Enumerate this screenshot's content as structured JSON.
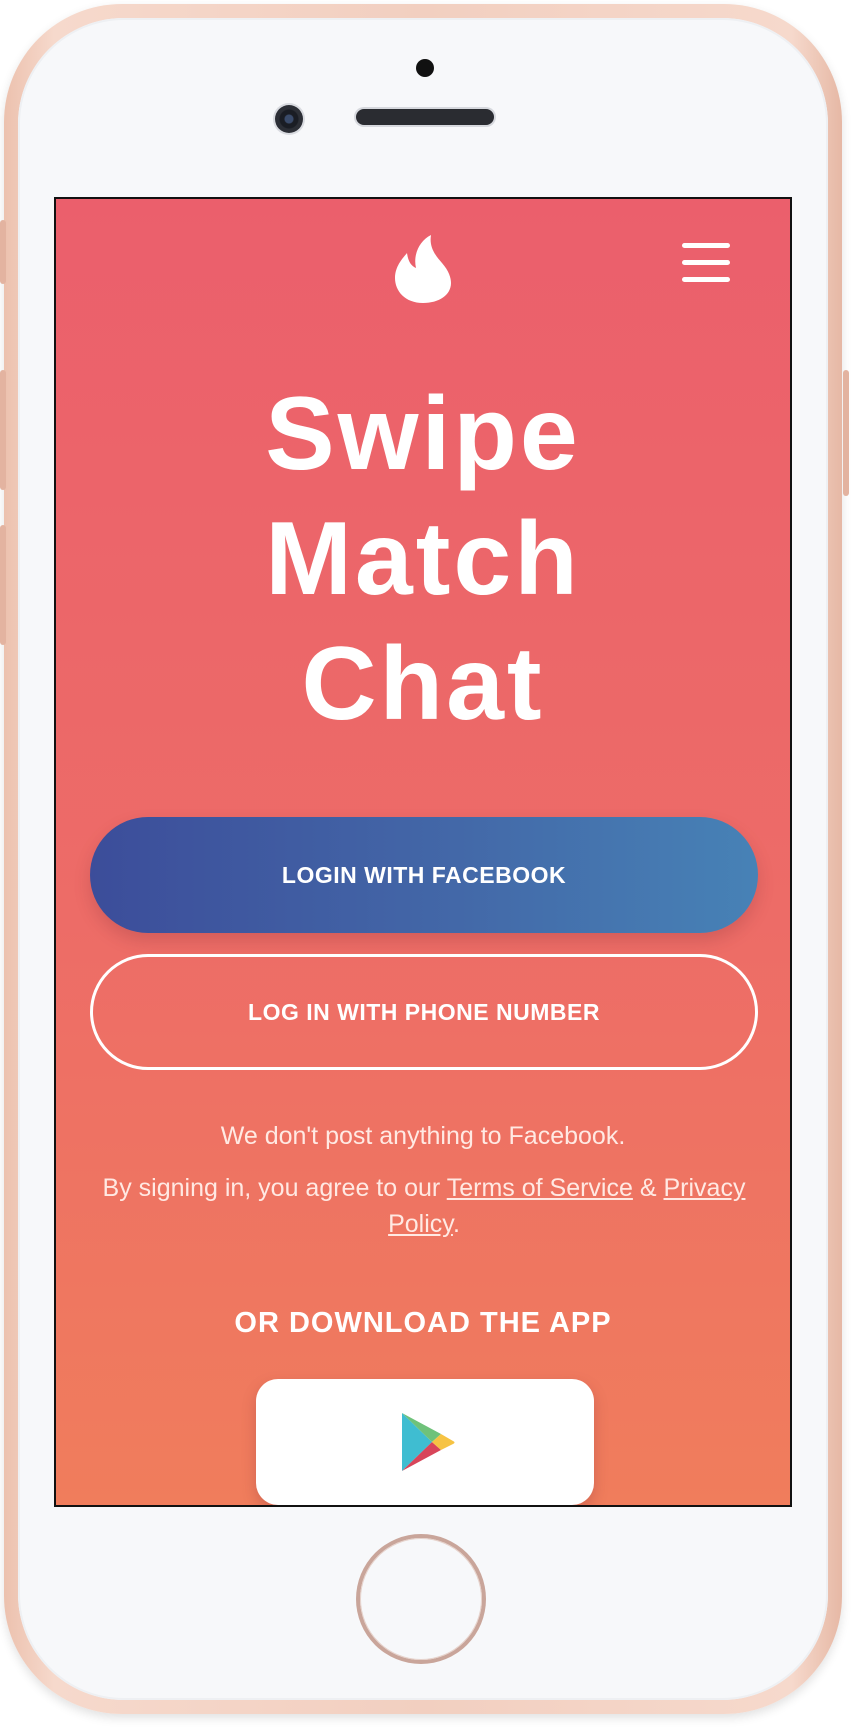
{
  "app": {
    "logo_icon": "tinder-flame-icon",
    "menu_icon": "hamburger-menu-icon"
  },
  "hero": {
    "line1": "Swipe",
    "line2": "Match",
    "line3": "Chat"
  },
  "actions": {
    "facebook_label": "LOGIN WITH FACEBOOK",
    "phone_label": "LOG IN WITH PHONE NUMBER"
  },
  "notice": {
    "facebook_note": "We don't post anything to Facebook.",
    "agree_prefix": "By signing in, you agree to our ",
    "terms_link": "Terms of Service",
    "ampersand": " & ",
    "privacy_link": "Privacy Policy",
    "period": "."
  },
  "download": {
    "title": "OR DOWNLOAD THE APP",
    "store_icon": "google-play-icon"
  },
  "colors": {
    "gradient_top": "#eb5f6c",
    "gradient_bottom": "#f07d5c",
    "facebook_left": "#3c4d9a",
    "facebook_right": "#4782b6"
  }
}
